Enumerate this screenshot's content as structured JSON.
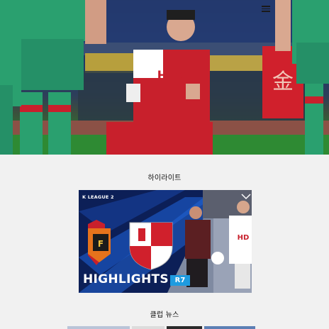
{
  "header": {
    "menu_icon": "hamburger-menu-icon"
  },
  "hero": {
    "shirt_text": "HDC",
    "sign_text": "金"
  },
  "sections": {
    "highlight_title": "하이라이트",
    "news_title": "클럽 뉴스"
  },
  "highlight_video": {
    "league_badge": "K LEAGUE 2",
    "headline": "HIGHLIGHTS",
    "round": "R7",
    "player_shirt_text": "HD"
  },
  "colors": {
    "page_bg": "#f1f1f1",
    "home_kit_red": "#c8202c",
    "away_kit_green": "#2aa06f",
    "highlight_blue": "#1e9be0",
    "card_navy": "#0c1f57"
  }
}
